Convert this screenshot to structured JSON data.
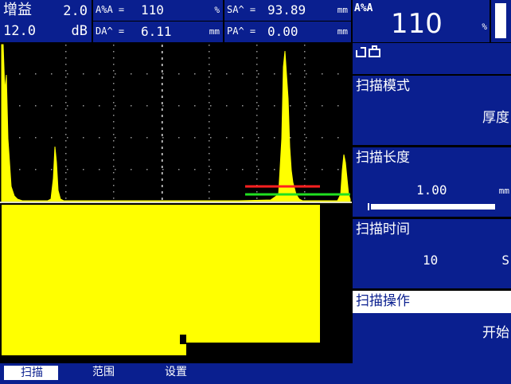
{
  "header": {
    "gain_label": "增益",
    "gain_step": "2.0",
    "gain_db": "12.0",
    "gain_unit": "dB",
    "a_pct_a_label": "A%A =",
    "a_pct_a_value": "110",
    "a_pct_a_unit": "%",
    "da_label": "DA^ =",
    "da_value": "6.11",
    "da_unit": "mm",
    "sa_label": "SA^ =",
    "sa_value": "93.89",
    "sa_unit": "mm",
    "pa_label": "PA^ =",
    "pa_value": "0.00",
    "pa_unit": "mm",
    "big_label": "A%A",
    "big_value": "110",
    "big_unit": "%"
  },
  "panel": {
    "scan_mode_label": "扫描模式",
    "scan_mode_value": "厚度",
    "scan_length_label": "扫描长度",
    "scan_length_value": "1.00",
    "scan_length_unit": "mm",
    "scan_length_fraction": 0.97,
    "scan_time_label": "扫描时间",
    "scan_time_value": "10",
    "scan_time_unit": "S",
    "scan_op_label": "扫描操作",
    "scan_op_value": "开始"
  },
  "bottom": {
    "tab_scan": "扫描",
    "tab_range": "范围",
    "tab_settings": "设置"
  },
  "colors": {
    "background": "#000000",
    "panel_blue": "#0a1f8f",
    "signal_yellow": "#ffff00",
    "gate_red": "#ff2020",
    "gate_green": "#20e020"
  },
  "icons": {
    "header_icon": "probe-status-icon"
  }
}
